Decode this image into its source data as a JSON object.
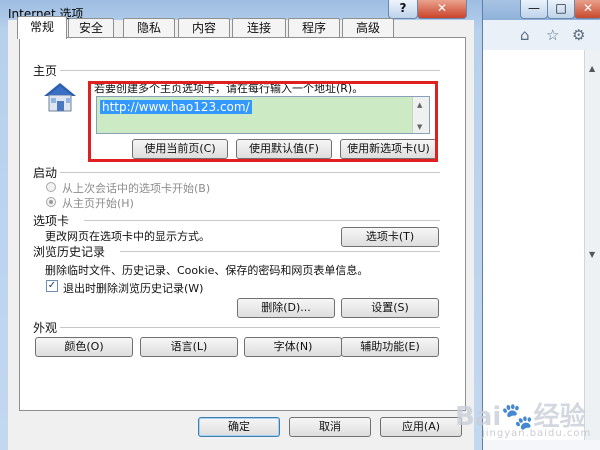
{
  "window": {
    "title": "Internet 选项",
    "help_label": "?",
    "close_label": "✕"
  },
  "tabs": [
    "常规",
    "安全",
    "隐私",
    "内容",
    "连接",
    "程序",
    "高级"
  ],
  "home": {
    "section": "主页",
    "instruction": "若要创建多个主页选项卡，请在每行输入一个地址(R)。",
    "url": "http://www.hao123.com/",
    "btn_current": "使用当前页(C)",
    "btn_default": "使用默认值(F)",
    "btn_new_tab": "使用新选项卡(U)"
  },
  "startup": {
    "section": "启动",
    "opt_last": "从上次会话中的选项卡开始(B)",
    "opt_home": "从主页开始(H)"
  },
  "tabsec": {
    "section": "选项卡",
    "desc": "更改网页在选项卡中的显示方式。",
    "btn": "选项卡(T)"
  },
  "history": {
    "section": "浏览历史记录",
    "desc": "删除临时文件、历史记录、Cookie、保存的密码和网页表单信息。",
    "checkbox_label": "退出时删除浏览历史记录(W)",
    "btn_delete": "删除(D)...",
    "btn_settings": "设置(S)"
  },
  "appearance": {
    "section": "外观",
    "btn_colors": "颜色(O)",
    "btn_languages": "语言(L)",
    "btn_fonts": "字体(N)",
    "btn_accessibility": "辅助功能(E)"
  },
  "footer": {
    "ok": "确定",
    "cancel": "取消",
    "apply": "应用(A)"
  },
  "browser": {
    "min_label": "—",
    "max_label": "□",
    "close_label": "✕"
  },
  "watermark": {
    "brand": "Bai",
    "brand2": "经验",
    "url": "jingyan.baidu.com"
  },
  "colors": {
    "highlight": "#e02020",
    "url_field_bg": "#ccebc4",
    "selection": "#3399ff"
  }
}
